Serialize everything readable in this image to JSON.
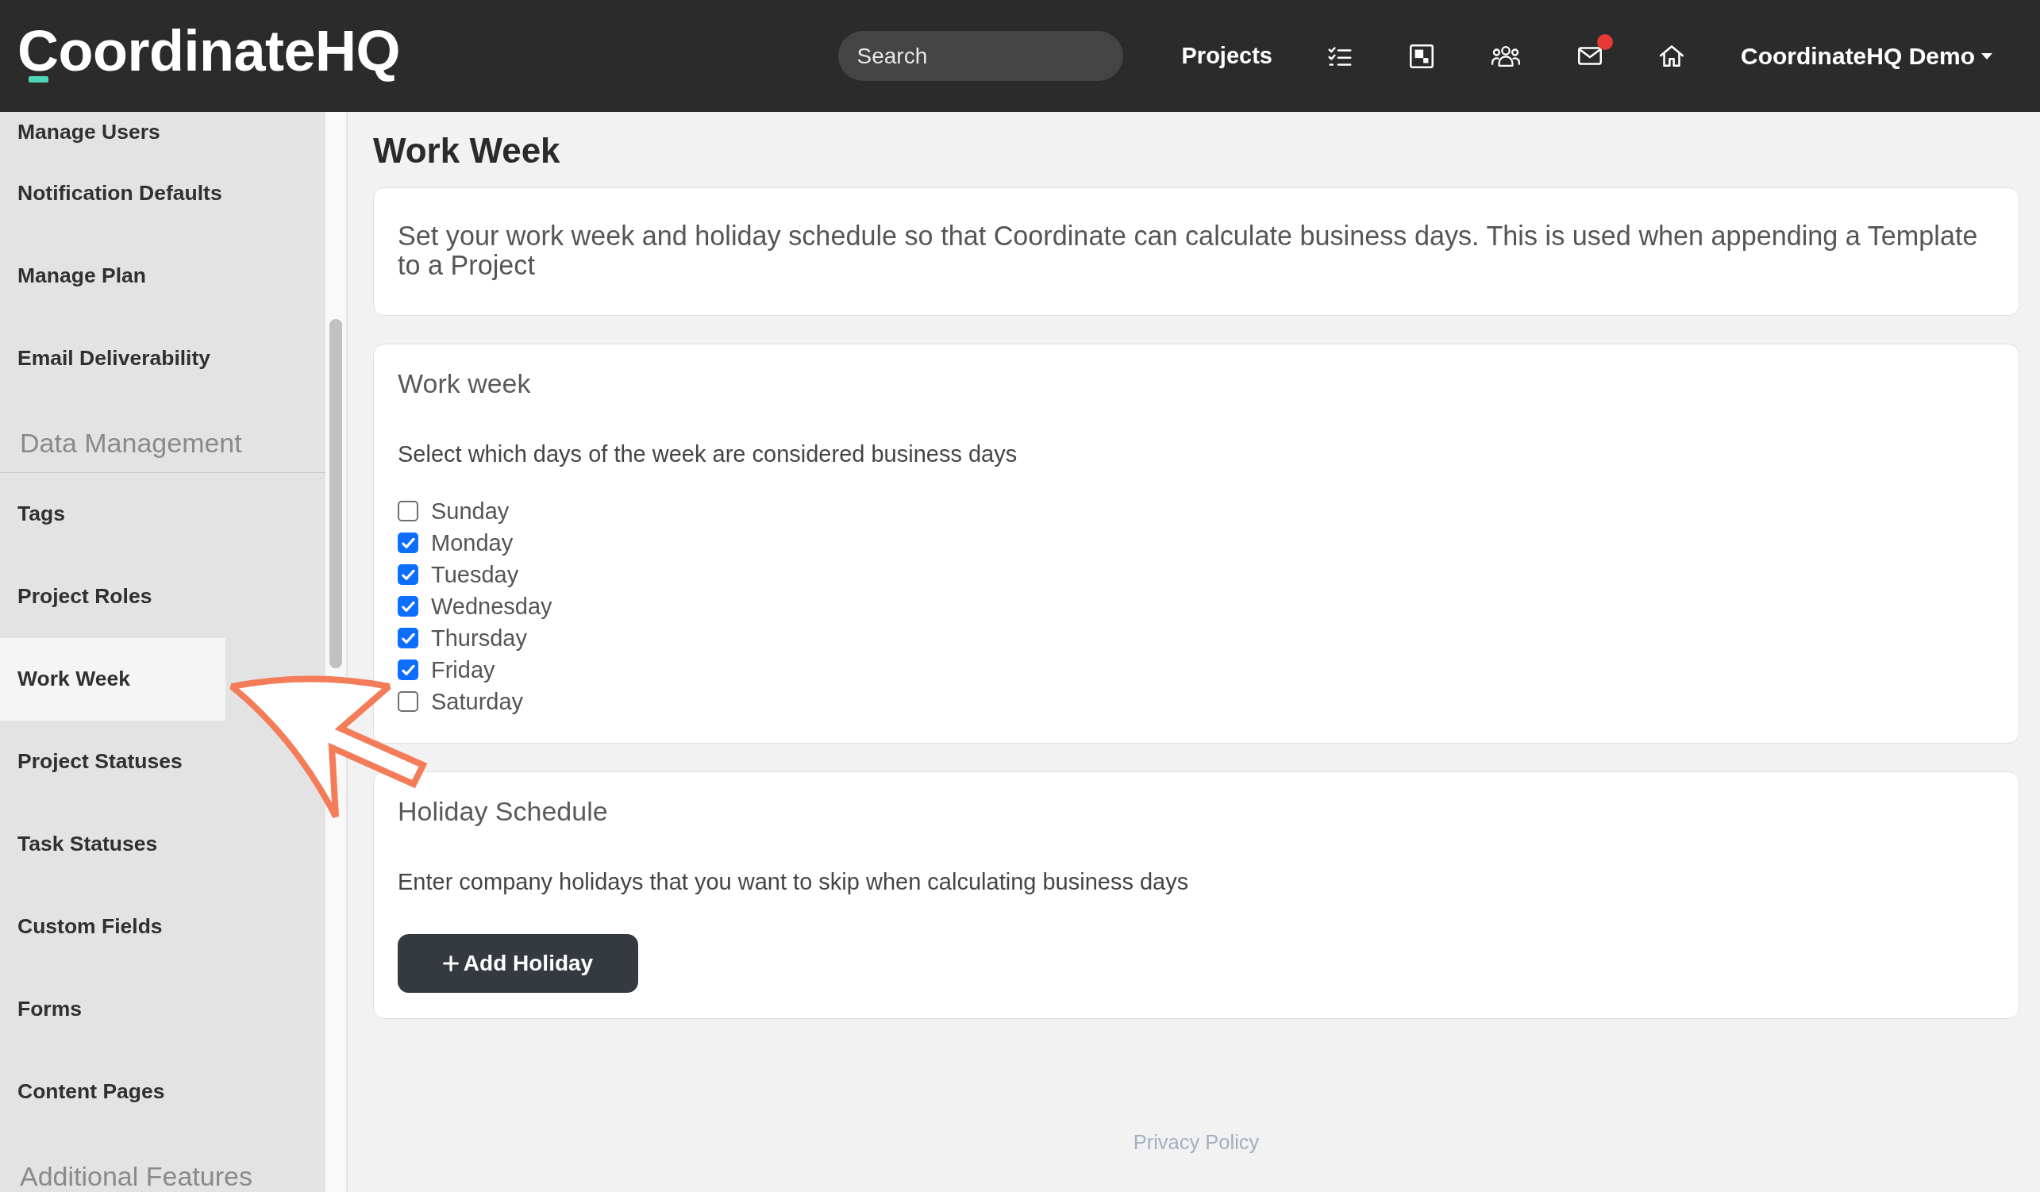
{
  "header": {
    "logo": "CoordinateHQ",
    "search": {
      "placeholder": "Search"
    },
    "nav_link": "Projects",
    "inbox_unread": true,
    "user_menu": "CoordinateHQ Demo"
  },
  "sidebar": {
    "sections": [
      {
        "items": [
          {
            "label": "Manage Users",
            "selected": false
          },
          {
            "label": "Notification Defaults",
            "selected": false
          },
          {
            "label": "Manage Plan",
            "selected": false
          },
          {
            "label": "Email Deliverability",
            "selected": false
          }
        ]
      },
      {
        "title": "Data Management",
        "items": [
          {
            "label": "Tags",
            "selected": false
          },
          {
            "label": "Project Roles",
            "selected": false
          },
          {
            "label": "Work Week",
            "selected": true
          },
          {
            "label": "Project Statuses",
            "selected": false
          },
          {
            "label": "Task Statuses",
            "selected": false
          },
          {
            "label": "Custom Fields",
            "selected": false
          },
          {
            "label": "Forms",
            "selected": false
          },
          {
            "label": "Content Pages",
            "selected": false
          }
        ]
      },
      {
        "title": "Additional Features"
      }
    ]
  },
  "page": {
    "title": "Work Week",
    "intro": "Set your work week and holiday schedule so that Coordinate can calculate business days. This is used when appending a Template to a Project"
  },
  "work_week": {
    "title": "Work week",
    "description": "Select which days of the week are considered business days",
    "days": [
      {
        "label": "Sunday",
        "checked": false
      },
      {
        "label": "Monday",
        "checked": true
      },
      {
        "label": "Tuesday",
        "checked": true
      },
      {
        "label": "Wednesday",
        "checked": true
      },
      {
        "label": "Thursday",
        "checked": true
      },
      {
        "label": "Friday",
        "checked": true
      },
      {
        "label": "Saturday",
        "checked": false
      }
    ]
  },
  "holiday_schedule": {
    "title": "Holiday Schedule",
    "description": "Enter company holidays that you want to skip when calculating business days",
    "button": "Add Holiday"
  },
  "footer": {
    "link": "Privacy Policy"
  }
}
